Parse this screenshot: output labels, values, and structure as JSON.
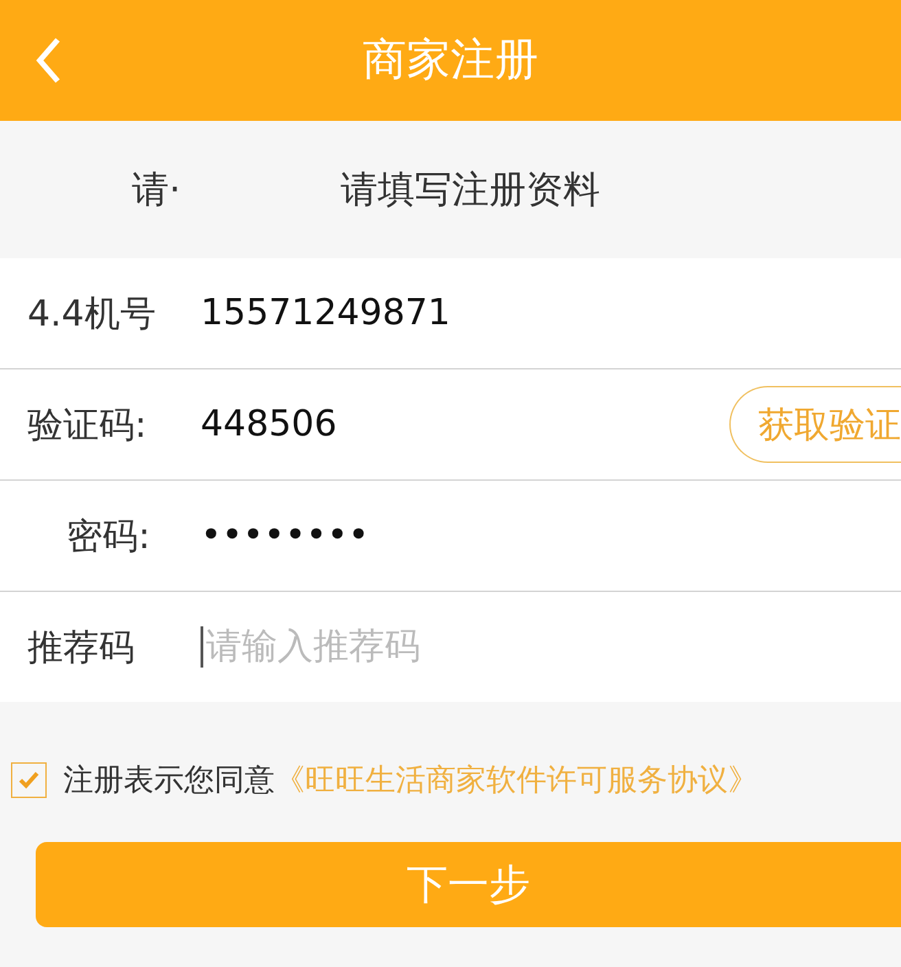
{
  "header": {
    "title": "商家注册"
  },
  "banner": {
    "hint": "请·",
    "title": "请填写注册资料"
  },
  "fields": [
    {
      "label": "4.4机号",
      "value": "15571249871"
    },
    {
      "label": "验证码:",
      "value": "448506",
      "action": "获取验证"
    },
    {
      "label": "密码:",
      "value": "••••••••"
    },
    {
      "label": "推荐码",
      "placeholder": "请输入推荐码",
      "focused": true
    }
  ],
  "agreement": {
    "checked": true,
    "text": "注册表示您同意",
    "link": "《旺旺生活商家软件许可服务协议》"
  },
  "next_button": "下一步"
}
